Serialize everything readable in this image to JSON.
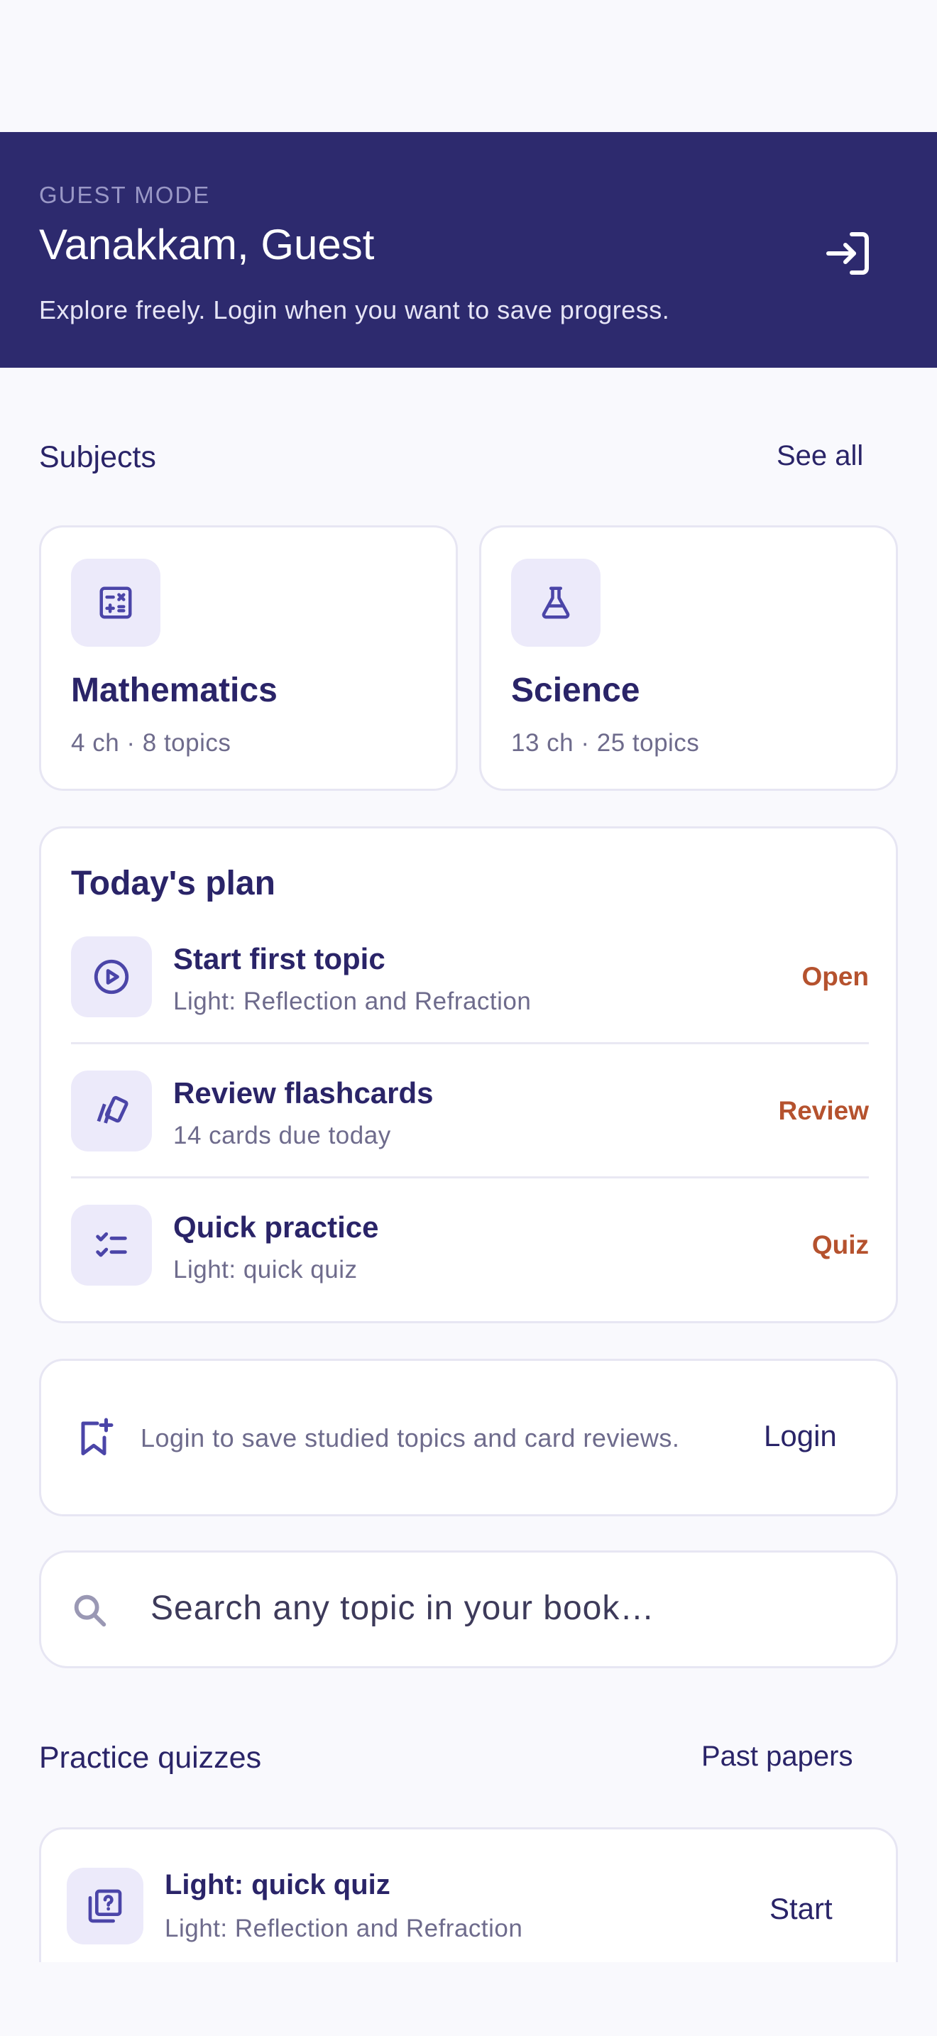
{
  "hero": {
    "tag": "GUEST MODE",
    "greeting": "Vanakkam, Guest",
    "subtitle": "Explore freely. Login when you want to save progress."
  },
  "subjects": {
    "title": "Subjects",
    "see_all": "See all",
    "items": [
      {
        "name": "Mathematics",
        "meta": "4 ch · 8 topics",
        "icon": "calculator-icon"
      },
      {
        "name": "Science",
        "meta": "13 ch · 25 topics",
        "icon": "flask-icon"
      }
    ]
  },
  "plan": {
    "title": "Today's plan",
    "items": [
      {
        "title": "Start first topic",
        "subtitle": "Light: Reflection and Refraction",
        "action": "Open",
        "icon": "play-circle-icon"
      },
      {
        "title": "Review flashcards",
        "subtitle": "14 cards due today",
        "action": "Review",
        "icon": "cards-icon"
      },
      {
        "title": "Quick practice",
        "subtitle": "Light: quick quiz",
        "action": "Quiz",
        "icon": "checklist-icon"
      }
    ]
  },
  "login_banner": {
    "text": "Login to save studied topics and card reviews.",
    "button": "Login",
    "icon": "bookmark-add-icon"
  },
  "search": {
    "placeholder": "Search any topic in your book…",
    "icon": "search-icon"
  },
  "quizzes": {
    "title": "Practice quizzes",
    "link": "Past papers",
    "items": [
      {
        "title": "Light: quick quiz",
        "subtitle": "Light: Reflection and Refraction",
        "action": "Start",
        "icon": "quiz-icon"
      }
    ]
  },
  "colors": {
    "hero_bg": "#2D2A6E",
    "primary_text": "#2A2468",
    "accent_action": "#B5522E",
    "icon_tile": "#ECEAFA",
    "icon_stroke": "#4B45A8"
  }
}
